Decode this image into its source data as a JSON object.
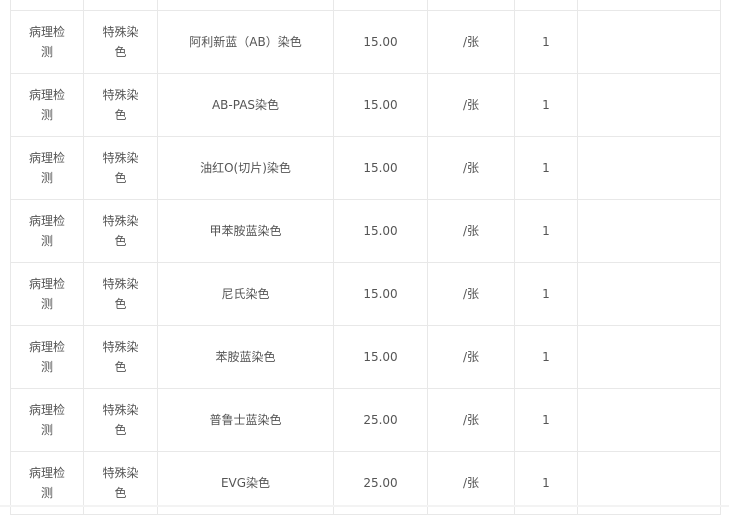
{
  "table": {
    "rows": [
      {
        "category": "病理检测",
        "type": "特殊染色",
        "name": "阿利新蓝（AB）染色",
        "price": "15.00",
        "unit": "/张",
        "qty": "1",
        "note": ""
      },
      {
        "category": "病理检测",
        "type": "特殊染色",
        "name": "AB-PAS染色",
        "price": "15.00",
        "unit": "/张",
        "qty": "1",
        "note": ""
      },
      {
        "category": "病理检测",
        "type": "特殊染色",
        "name": "油红O(切片)染色",
        "price": "15.00",
        "unit": "/张",
        "qty": "1",
        "note": ""
      },
      {
        "category": "病理检测",
        "type": "特殊染色",
        "name": "甲苯胺蓝染色",
        "price": "15.00",
        "unit": "/张",
        "qty": "1",
        "note": ""
      },
      {
        "category": "病理检测",
        "type": "特殊染色",
        "name": "尼氏染色",
        "price": "15.00",
        "unit": "/张",
        "qty": "1",
        "note": ""
      },
      {
        "category": "病理检测",
        "type": "特殊染色",
        "name": "苯胺蓝染色",
        "price": "15.00",
        "unit": "/张",
        "qty": "1",
        "note": ""
      },
      {
        "category": "病理检测",
        "type": "特殊染色",
        "name": "普鲁士蓝染色",
        "price": "25.00",
        "unit": "/张",
        "qty": "1",
        "note": ""
      },
      {
        "category": "病理检测",
        "type": "特殊染色",
        "name": "EVG染色",
        "price": "25.00",
        "unit": "/张",
        "qty": "1",
        "note": ""
      }
    ]
  }
}
